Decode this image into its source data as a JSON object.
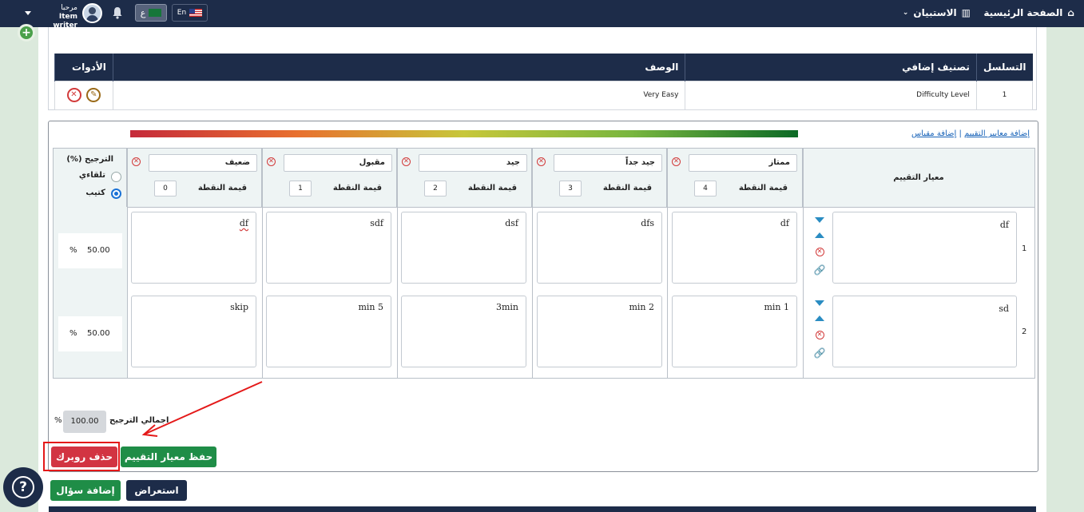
{
  "topbar": {
    "home_label": "الصفحة الرئيسية",
    "survey_label": "الاستبيان",
    "lang_en": "En",
    "lang_ar": "ع",
    "greeting": "مرحبا",
    "role": "Item writer"
  },
  "classification_table": {
    "headers": {
      "serial": "التسلسل",
      "extra": "تصنيف إضافي",
      "desc": "الوصف",
      "tools": "الأدوات"
    },
    "rows": [
      {
        "serial": "1",
        "extra": "Difficulty Level",
        "desc": "Very Easy"
      }
    ]
  },
  "rubric": {
    "links": {
      "add_criteria": "إضافة معايير التقييم",
      "separator": "|",
      "add_scale": "إضافة مقياس"
    },
    "criteria_header": "معيار التقييم",
    "weight_header": "(%) الترجيح",
    "weight_modes": {
      "auto": "تلقاءي",
      "writer": "كتيب"
    },
    "point_label": "قيمة النقطة",
    "levels": [
      {
        "name": "ممتاز",
        "points": "4"
      },
      {
        "name": "جيد جداً",
        "points": "3"
      },
      {
        "name": "جيد",
        "points": "2"
      },
      {
        "name": "مقبول",
        "points": "1"
      },
      {
        "name": "ضعيف",
        "points": "0"
      }
    ],
    "rows": [
      {
        "num": "1",
        "criterion": "df",
        "weight": "50.00",
        "pct": "%",
        "cells": [
          "df",
          "dfs",
          "dsf",
          "sdf",
          "df"
        ]
      },
      {
        "num": "2",
        "criterion": "sd",
        "weight": "50.00",
        "pct": "%",
        "cells": [
          "min 1",
          "min 2",
          "3min",
          "min 5",
          "skip"
        ]
      }
    ],
    "total_label": "اجمالي الترجيح",
    "total_value": "100.00",
    "total_pct": "%",
    "save_button": "حفظ معيار التقييم",
    "delete_button": "حذف روبرك"
  },
  "footer_buttons": {
    "preview": "استعراض",
    "add_question": "إضافة سؤال"
  }
}
